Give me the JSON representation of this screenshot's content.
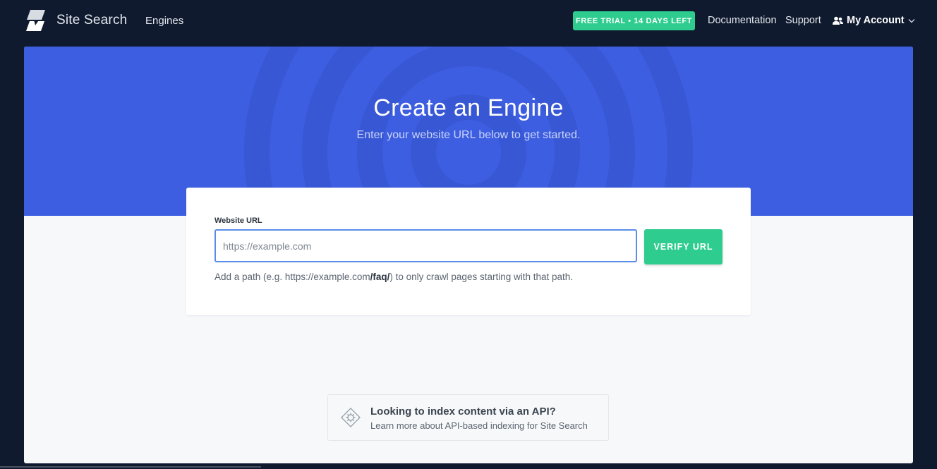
{
  "header": {
    "brand": "Site Search",
    "nav_engines": "Engines",
    "trial_badge": "FREE TRIAL • 14 DAYS LEFT",
    "documentation": "Documentation",
    "support": "Support",
    "account": "My Account"
  },
  "hero": {
    "title": "Create an Engine",
    "subtitle": "Enter your website URL below to get started."
  },
  "form": {
    "label": "Website URL",
    "placeholder": "https://example.com",
    "value": "",
    "verify_button": "VERIFY URL",
    "hint_before": "Add a path (e.g. https://example.com",
    "hint_bold": "/faq/",
    "hint_after": ") to only crawl pages starting with that path."
  },
  "api_card": {
    "title": "Looking to index content via an API?",
    "subtitle": "Learn more about API-based indexing for Site Search"
  },
  "icons": {
    "logo": "swiftype-logo-icon",
    "account": "users-icon",
    "chevron": "chevron-down-icon",
    "api": "gear-diamond-icon"
  },
  "colors": {
    "background": "#0f1a2e",
    "hero": "#3d5ee1",
    "accent_green": "#2ecc8f",
    "input_border": "#5a8de8",
    "panel": "#f7f8fa"
  }
}
